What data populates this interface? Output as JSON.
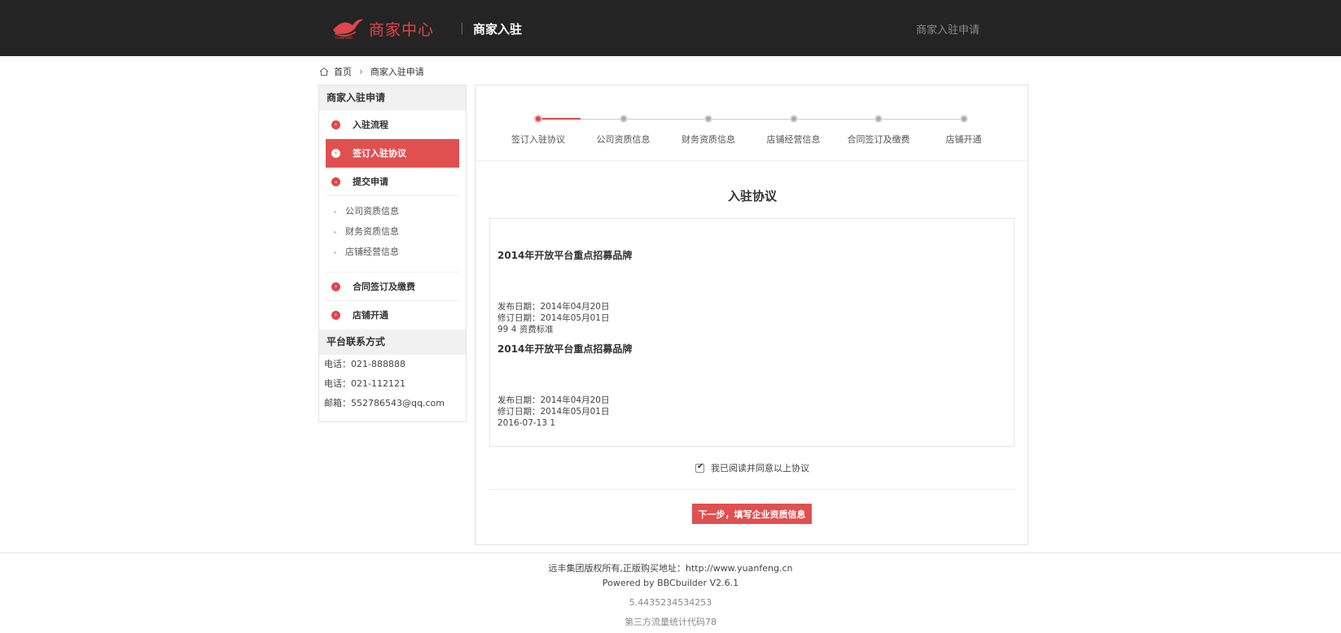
{
  "header": {
    "logo_text": "商家中心",
    "logo_small": "YUANFENG",
    "divider": "|",
    "subtitle": "商家入驻",
    "right_link": "商家入驻申请"
  },
  "breadcrumb": {
    "home": "首页",
    "current": "商家入驻申请"
  },
  "sidebar": {
    "title": "商家入驻申请",
    "items": [
      {
        "label": "入驻流程"
      },
      {
        "label": "签订入驻协议"
      },
      {
        "label": "提交申请"
      }
    ],
    "subitems": [
      "公司资质信息",
      "财务资质信息",
      "店铺经营信息"
    ],
    "items_after": [
      {
        "label": "合同签订及缴费"
      },
      {
        "label": "店铺开通"
      }
    ],
    "contact_title": "平台联系方式",
    "contacts": [
      "电话：021-888888",
      "电话：021-112121",
      "邮箱：552786543@qq.com"
    ]
  },
  "steps": {
    "labels": [
      "签订入驻协议",
      "公司资质信息",
      "财务资质信息",
      "店铺经营信息",
      "合同签订及缴费",
      "店铺开通"
    ],
    "active_index": 0
  },
  "agreement": {
    "title": "入驻协议",
    "articles": [
      {
        "title": "2014年开放平台重点招募品牌",
        "lines": [
          "发布日期：2014年04月20日",
          "修订日期：2014年05月01日",
          "99 4 资费标准"
        ]
      },
      {
        "title": "2014年开放平台重点招募品牌",
        "lines": [
          "发布日期：2014年04月20日",
          "修订日期：2014年05月01日",
          "2016-07-13 1"
        ]
      }
    ],
    "checkbox_label": "我已阅读并同意以上协议",
    "checked": true,
    "next_button": "下一步，填写企业资质信息"
  },
  "footer": {
    "copyright": "远丰集团版权所有,正版购买地址：http://www.yuanfeng.cn",
    "powered": "Powered by BBCbuilder V2.6.1",
    "code": "5.4435234534253",
    "stats": "第三方流量统计代码78"
  },
  "colors": {
    "accent": "#e05050",
    "header_bg": "#242424"
  }
}
